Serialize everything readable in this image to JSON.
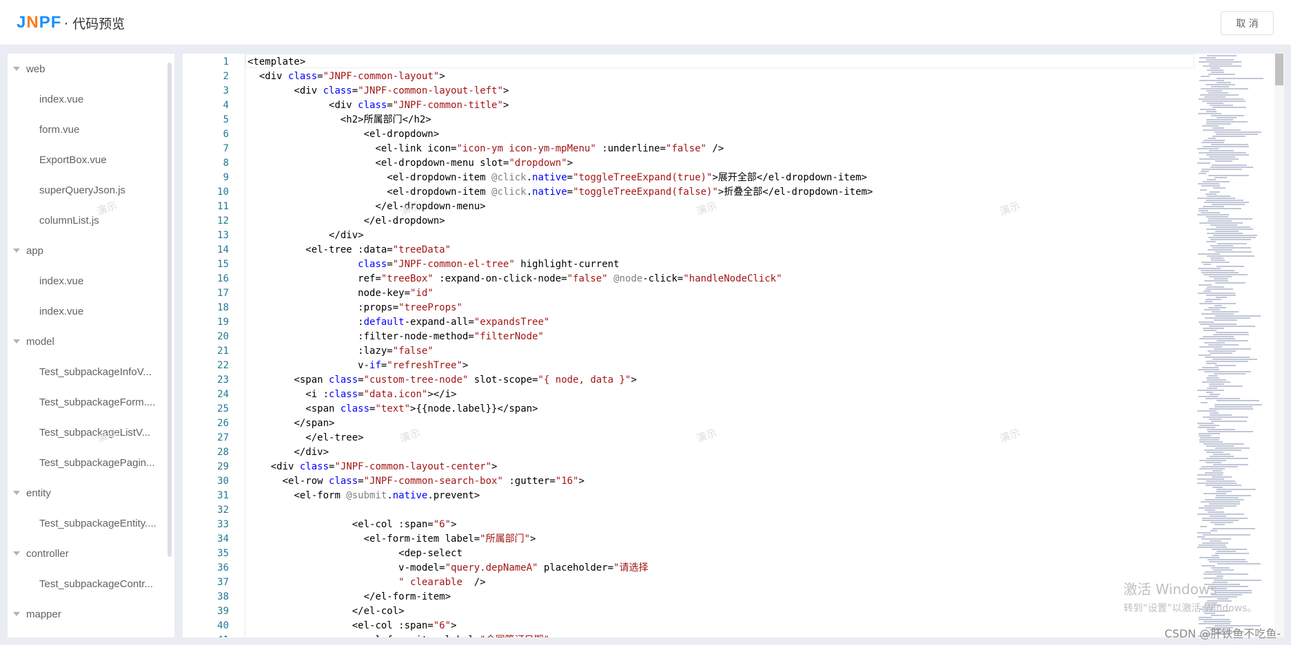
{
  "header": {
    "logo_j": "J",
    "logo_n": "N",
    "logo_pf": "PF",
    "title": "· 代码预览",
    "cancel_label": "取 消"
  },
  "sidebar": {
    "nodes": [
      {
        "type": "folder",
        "label": "web"
      },
      {
        "type": "file",
        "label": "index.vue"
      },
      {
        "type": "file",
        "label": "form.vue"
      },
      {
        "type": "file",
        "label": "ExportBox.vue"
      },
      {
        "type": "file",
        "label": "superQueryJson.js"
      },
      {
        "type": "file",
        "label": "columnList.js"
      },
      {
        "type": "folder",
        "label": "app"
      },
      {
        "type": "file",
        "label": "index.vue"
      },
      {
        "type": "file",
        "label": "index.vue"
      },
      {
        "type": "folder",
        "label": "model"
      },
      {
        "type": "file",
        "label": "Test_subpackageInfoV..."
      },
      {
        "type": "file",
        "label": "Test_subpackageForm...."
      },
      {
        "type": "file",
        "label": "Test_subpackageListV..."
      },
      {
        "type": "file",
        "label": "Test_subpackagePagin..."
      },
      {
        "type": "folder",
        "label": "entity"
      },
      {
        "type": "file",
        "label": "Test_subpackageEntity...."
      },
      {
        "type": "folder",
        "label": "controller"
      },
      {
        "type": "file",
        "label": "Test_subpackageContr..."
      },
      {
        "type": "folder",
        "label": "mapper"
      }
    ]
  },
  "editor": {
    "lines": [
      {
        "n": "1",
        "indent": 0,
        "segs": [
          [
            "t",
            "<template>"
          ]
        ]
      },
      {
        "n": "2",
        "indent": 2,
        "segs": [
          [
            "t",
            "<div "
          ],
          [
            "a",
            "class"
          ],
          [
            "t",
            "="
          ],
          [
            "s",
            "\"JNPF-common-layout\""
          ],
          [
            "t",
            ">"
          ]
        ]
      },
      {
        "n": "3",
        "indent": 8,
        "segs": [
          [
            "t",
            "<div "
          ],
          [
            "a",
            "class"
          ],
          [
            "t",
            "="
          ],
          [
            "s",
            "\"JNPF-common-layout-left\""
          ],
          [
            "t",
            ">"
          ]
        ]
      },
      {
        "n": "4",
        "indent": 14,
        "segs": [
          [
            "t",
            "<div "
          ],
          [
            "a",
            "class"
          ],
          [
            "t",
            "="
          ],
          [
            "s",
            "\"JNPF-common-title\""
          ],
          [
            "t",
            ">"
          ]
        ]
      },
      {
        "n": "5",
        "indent": 16,
        "segs": [
          [
            "t",
            "<h2>所属部门</h2>"
          ]
        ]
      },
      {
        "n": "6",
        "indent": 20,
        "segs": [
          [
            "t",
            "<el-dropdown>"
          ]
        ]
      },
      {
        "n": "7",
        "indent": 22,
        "segs": [
          [
            "t",
            "<el-link icon="
          ],
          [
            "s",
            "\"icon-ym icon-ym-mpMenu\""
          ],
          [
            "t",
            " :underline="
          ],
          [
            "s",
            "\"false\""
          ],
          [
            "t",
            " />"
          ]
        ]
      },
      {
        "n": "8",
        "indent": 22,
        "segs": [
          [
            "t",
            "<el-dropdown-menu slot="
          ],
          [
            "s",
            "\"dropdown\""
          ],
          [
            "t",
            ">"
          ]
        ]
      },
      {
        "n": "9",
        "indent": 24,
        "segs": [
          [
            "t",
            "<el-dropdown-item "
          ],
          [
            "d",
            "@click"
          ],
          [
            "t",
            "."
          ],
          [
            "a",
            "native"
          ],
          [
            "t",
            "="
          ],
          [
            "s",
            "\"toggleTreeExpand(true)\""
          ],
          [
            "t",
            ">展开全部</el-dropdown-item>"
          ]
        ]
      },
      {
        "n": "10",
        "indent": 24,
        "segs": [
          [
            "t",
            "<el-dropdown-item "
          ],
          [
            "d",
            "@click"
          ],
          [
            "t",
            "."
          ],
          [
            "a",
            "native"
          ],
          [
            "t",
            "="
          ],
          [
            "s",
            "\"toggleTreeExpand(false)\""
          ],
          [
            "t",
            ">折叠全部</el-dropdown-item>"
          ]
        ]
      },
      {
        "n": "11",
        "indent": 22,
        "segs": [
          [
            "t",
            "</el-dropdown-menu>"
          ]
        ]
      },
      {
        "n": "12",
        "indent": 20,
        "segs": [
          [
            "t",
            "</el-dropdown>"
          ]
        ]
      },
      {
        "n": "13",
        "indent": 14,
        "segs": [
          [
            "t",
            "</div>"
          ]
        ]
      },
      {
        "n": "14",
        "indent": 10,
        "segs": [
          [
            "t",
            "<el-tree :data="
          ],
          [
            "s",
            "\"treeData\""
          ]
        ]
      },
      {
        "n": "15",
        "indent": 19,
        "segs": [
          [
            "a",
            "class"
          ],
          [
            "t",
            "="
          ],
          [
            "s",
            "\"JNPF-common-el-tree\""
          ],
          [
            "t",
            " highlight-current"
          ]
        ]
      },
      {
        "n": "16",
        "indent": 19,
        "segs": [
          [
            "t",
            "ref="
          ],
          [
            "s",
            "\"treeBox\""
          ],
          [
            "t",
            " :expand-on-click-node="
          ],
          [
            "s",
            "\"false\""
          ],
          [
            "t",
            " "
          ],
          [
            "d",
            "@node"
          ],
          [
            "t",
            "-click="
          ],
          [
            "s",
            "\"handleNodeClick\""
          ]
        ]
      },
      {
        "n": "17",
        "indent": 19,
        "segs": [
          [
            "t",
            "node-key="
          ],
          [
            "s",
            "\"id\""
          ]
        ]
      },
      {
        "n": "18",
        "indent": 19,
        "segs": [
          [
            "t",
            ":props="
          ],
          [
            "s",
            "\"treeProps\""
          ]
        ]
      },
      {
        "n": "19",
        "indent": 19,
        "segs": [
          [
            "t",
            ":"
          ],
          [
            "a",
            "default"
          ],
          [
            "t",
            "-expand-all="
          ],
          [
            "s",
            "\"expandsTree\""
          ]
        ]
      },
      {
        "n": "20",
        "indent": 19,
        "segs": [
          [
            "t",
            ":filter-node-method="
          ],
          [
            "s",
            "\"filterNode\""
          ]
        ]
      },
      {
        "n": "21",
        "indent": 19,
        "segs": [
          [
            "t",
            ":lazy="
          ],
          [
            "s",
            "\"false\""
          ]
        ]
      },
      {
        "n": "22",
        "indent": 19,
        "segs": [
          [
            "t",
            "v-"
          ],
          [
            "a",
            "if"
          ],
          [
            "t",
            "="
          ],
          [
            "s",
            "\"refreshTree\""
          ],
          [
            "t",
            ">"
          ]
        ]
      },
      {
        "n": "23",
        "indent": 8,
        "segs": [
          [
            "t",
            "<span "
          ],
          [
            "a",
            "class"
          ],
          [
            "t",
            "="
          ],
          [
            "s",
            "\"custom-tree-node\""
          ],
          [
            "t",
            " slot-scope="
          ],
          [
            "s",
            "\"{ node, data }\""
          ],
          [
            "t",
            ">"
          ]
        ]
      },
      {
        "n": "24",
        "indent": 10,
        "segs": [
          [
            "t",
            "<i :"
          ],
          [
            "a",
            "class"
          ],
          [
            "t",
            "="
          ],
          [
            "s",
            "\"data.icon\""
          ],
          [
            "t",
            "></i>"
          ]
        ]
      },
      {
        "n": "25",
        "indent": 10,
        "segs": [
          [
            "t",
            "<span "
          ],
          [
            "a",
            "class"
          ],
          [
            "t",
            "="
          ],
          [
            "s",
            "\"text\""
          ],
          [
            "t",
            ">{{node.label}}</span>"
          ]
        ]
      },
      {
        "n": "26",
        "indent": 8,
        "segs": [
          [
            "t",
            "</span>"
          ]
        ]
      },
      {
        "n": "27",
        "indent": 10,
        "segs": [
          [
            "t",
            "</el-tree>"
          ]
        ]
      },
      {
        "n": "28",
        "indent": 8,
        "segs": [
          [
            "t",
            "</div>"
          ]
        ]
      },
      {
        "n": "29",
        "indent": 4,
        "segs": [
          [
            "t",
            "<div "
          ],
          [
            "a",
            "class"
          ],
          [
            "t",
            "="
          ],
          [
            "s",
            "\"JNPF-common-layout-center\""
          ],
          [
            "t",
            ">"
          ]
        ]
      },
      {
        "n": "30",
        "indent": 6,
        "segs": [
          [
            "t",
            "<el-row "
          ],
          [
            "a",
            "class"
          ],
          [
            "t",
            "="
          ],
          [
            "s",
            "\"JNPF-common-search-box\""
          ],
          [
            "t",
            " :gutter="
          ],
          [
            "s",
            "\"16\""
          ],
          [
            "t",
            ">"
          ]
        ]
      },
      {
        "n": "31",
        "indent": 8,
        "segs": [
          [
            "t",
            "<el-form "
          ],
          [
            "d",
            "@submit"
          ],
          [
            "t",
            "."
          ],
          [
            "a",
            "native"
          ],
          [
            "t",
            ".prevent>"
          ]
        ]
      },
      {
        "n": "32",
        "indent": 0,
        "segs": [
          [
            "t",
            ""
          ]
        ]
      },
      {
        "n": "33",
        "indent": 18,
        "segs": [
          [
            "t",
            "<el-col :span="
          ],
          [
            "s",
            "\"6\""
          ],
          [
            "t",
            ">"
          ]
        ]
      },
      {
        "n": "34",
        "indent": 20,
        "segs": [
          [
            "t",
            "<el-form-item label="
          ],
          [
            "s",
            "\"所属部门\""
          ],
          [
            "t",
            ">"
          ]
        ]
      },
      {
        "n": "35",
        "indent": 26,
        "segs": [
          [
            "t",
            "<dep-select"
          ]
        ]
      },
      {
        "n": "36",
        "indent": 26,
        "segs": [
          [
            "t",
            "v-model="
          ],
          [
            "s",
            "\"query.depNameA\""
          ],
          [
            "t",
            " placeholder="
          ],
          [
            "s",
            "\"请选择"
          ]
        ]
      },
      {
        "n": "37",
        "indent": 26,
        "segs": [
          [
            "s",
            "\" clearable "
          ],
          [
            "t",
            " />"
          ]
        ]
      },
      {
        "n": "38",
        "indent": 20,
        "segs": [
          [
            "t",
            "</el-form-item>"
          ]
        ]
      },
      {
        "n": "39",
        "indent": 18,
        "segs": [
          [
            "t",
            "</el-col>"
          ]
        ]
      },
      {
        "n": "40",
        "indent": 18,
        "segs": [
          [
            "t",
            "<el-col :span="
          ],
          [
            "s",
            "\"6\""
          ],
          [
            "t",
            ">"
          ]
        ]
      },
      {
        "n": "41",
        "indent": 20,
        "segs": [
          [
            "t",
            "<el-form-item label="
          ],
          [
            "s",
            "\"合同签订日期\""
          ],
          [
            "t",
            ">"
          ]
        ]
      }
    ]
  },
  "watermarks": [
    "演示",
    "演示",
    "演示",
    "演示",
    "演示",
    "演示",
    "演示",
    "演示"
  ],
  "windows_activation": {
    "line1": "激活 Windows",
    "line2": "转到“设置”以激活 Windows。"
  },
  "csdn_credit": "CSDN @肝铁鱼不吃鱼-"
}
